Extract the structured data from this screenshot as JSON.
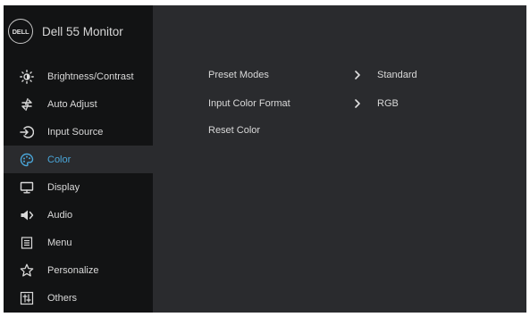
{
  "header": {
    "logo_text": "DELL",
    "model": "Dell 55 Monitor"
  },
  "sidebar": {
    "items": [
      {
        "label": "Brightness/Contrast",
        "icon": "brightness-icon"
      },
      {
        "label": "Auto Adjust",
        "icon": "auto-adjust-icon"
      },
      {
        "label": "Input Source",
        "icon": "input-source-icon"
      },
      {
        "label": "Color",
        "icon": "color-palette-icon",
        "active": true
      },
      {
        "label": "Display",
        "icon": "display-icon"
      },
      {
        "label": "Audio",
        "icon": "speaker-icon"
      },
      {
        "label": "Menu",
        "icon": "menu-icon"
      },
      {
        "label": "Personalize",
        "icon": "star-icon"
      },
      {
        "label": "Others",
        "icon": "others-icon"
      }
    ]
  },
  "content": {
    "rows": [
      {
        "label": "Preset Modes",
        "value": "Standard",
        "has_arrow": true
      },
      {
        "label": "Input Color Format",
        "value": "RGB",
        "has_arrow": true
      },
      {
        "label": "Reset Color",
        "value": "",
        "has_arrow": false
      }
    ]
  },
  "colors": {
    "accent": "#4aa6d9",
    "sidebar_bg": "#121314",
    "panel_bg": "#2a2b2e",
    "text": "#d9d9d9"
  }
}
